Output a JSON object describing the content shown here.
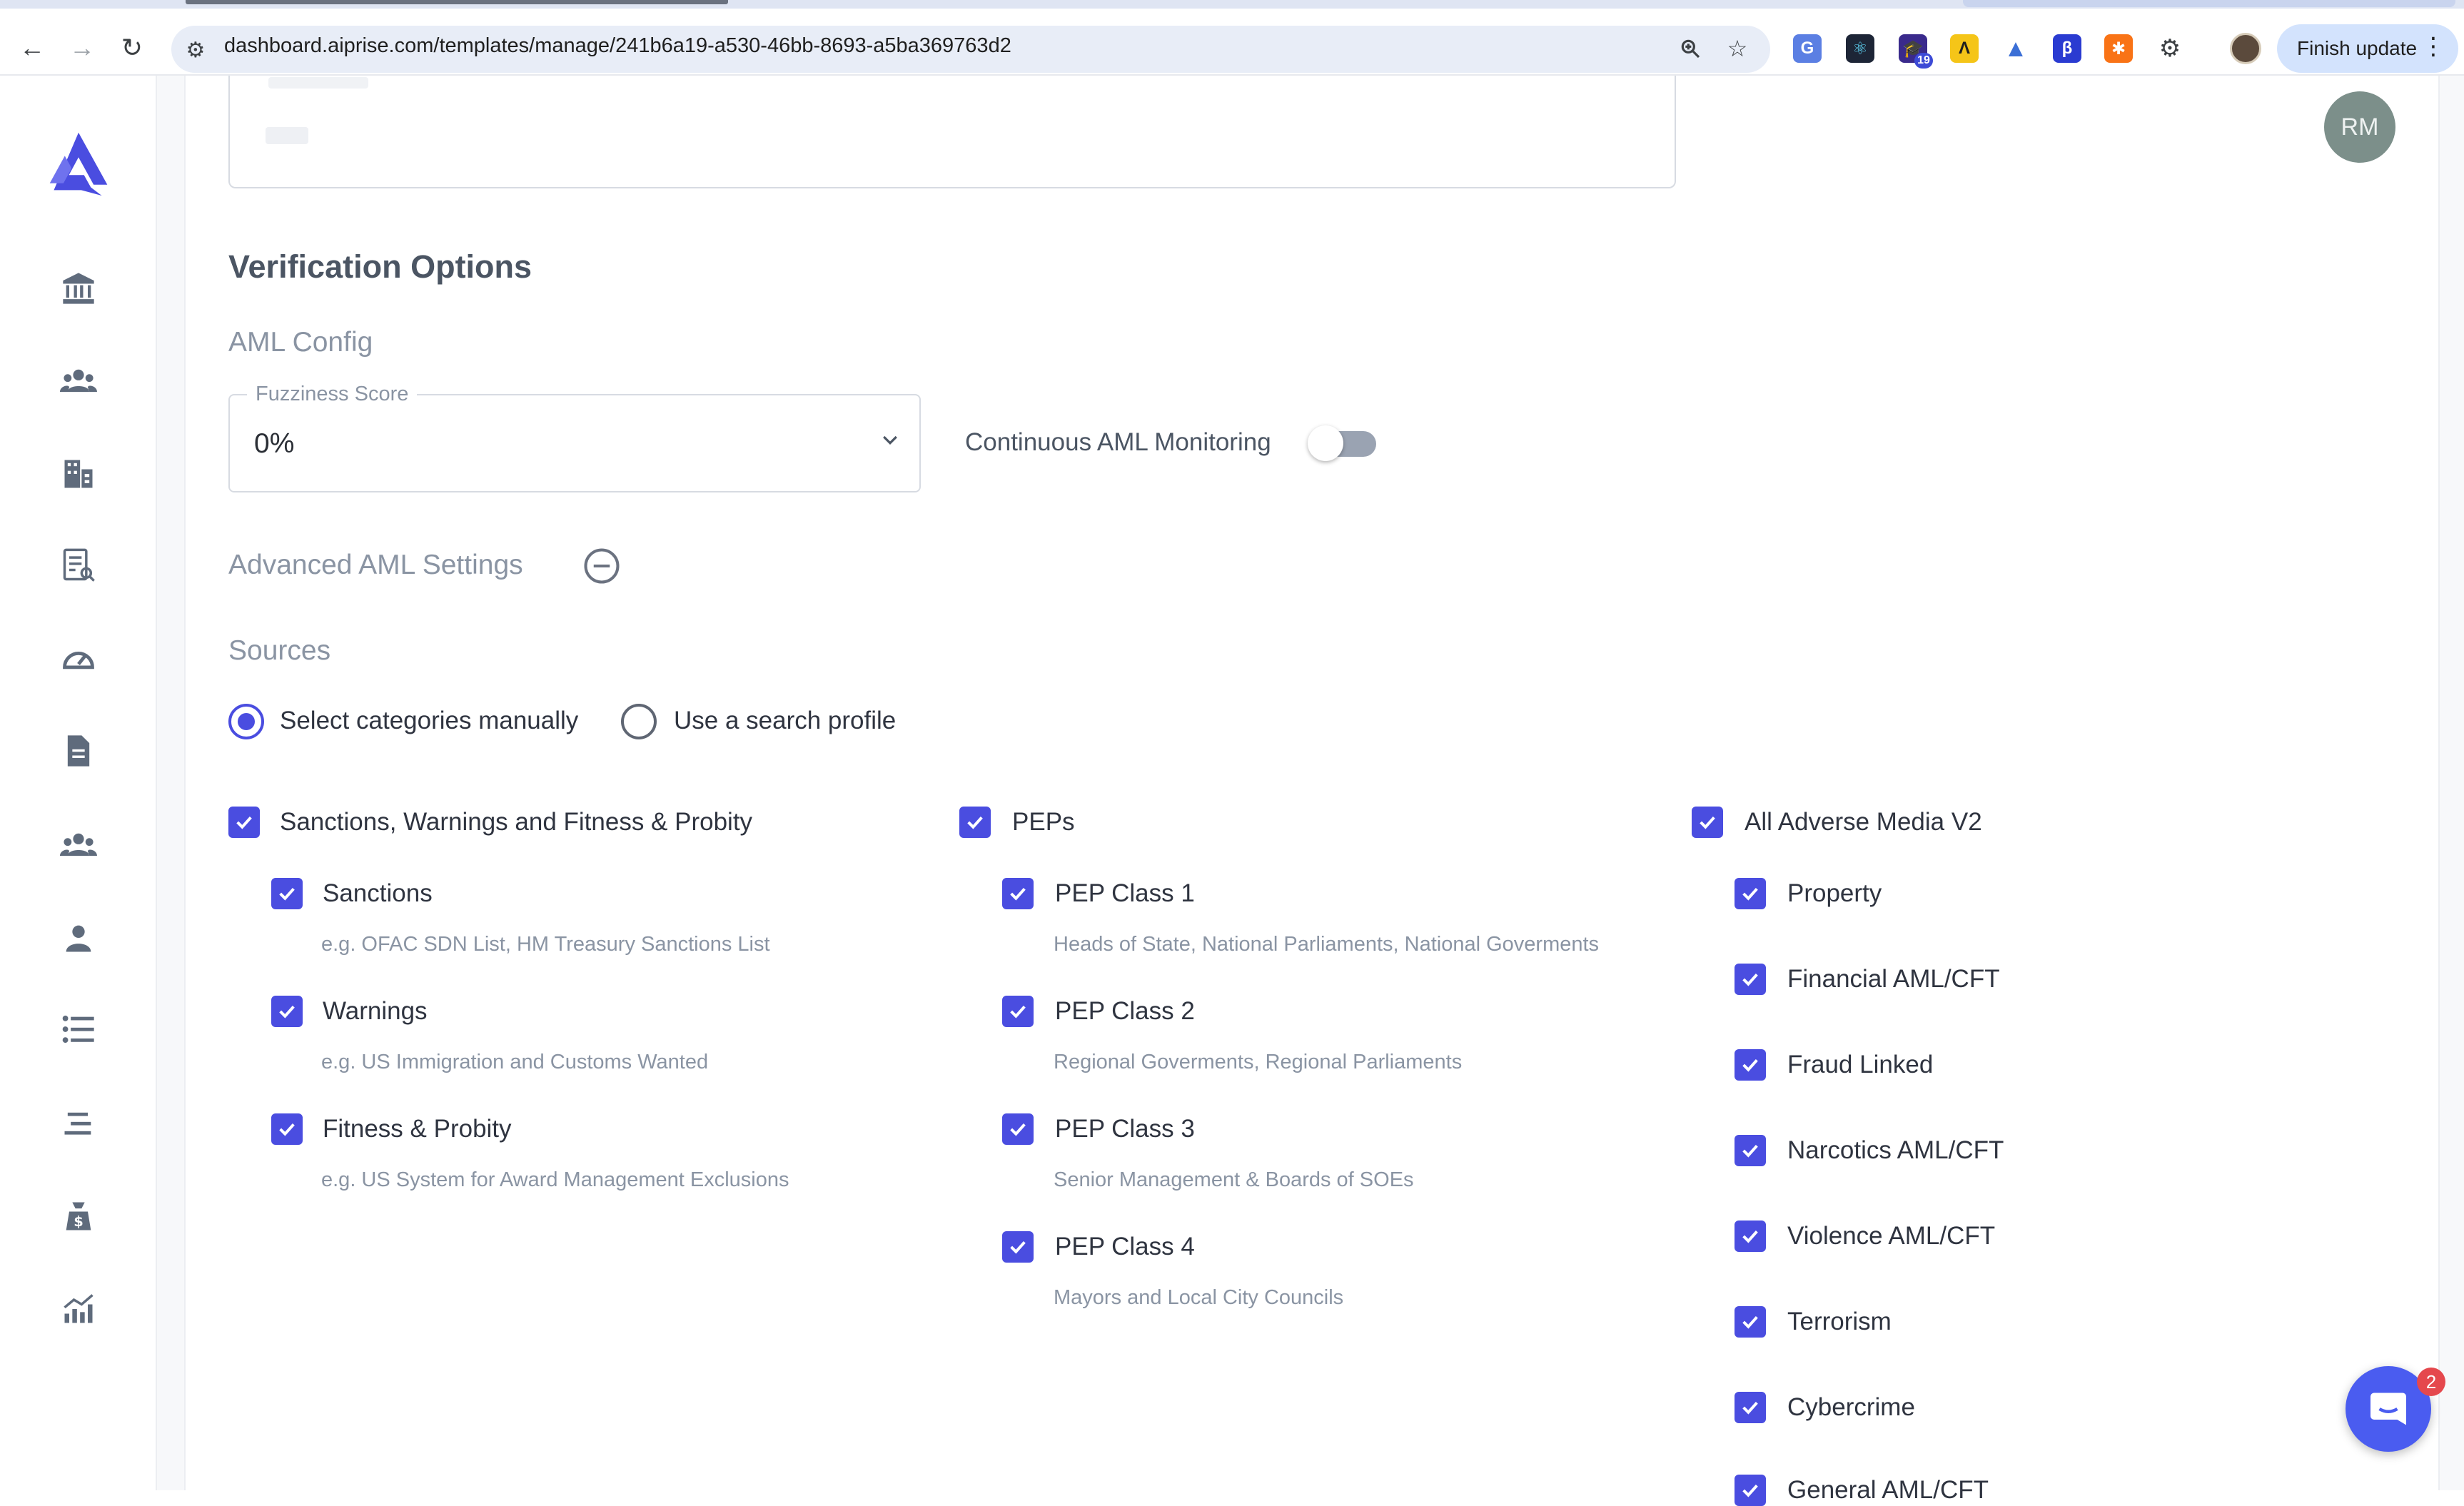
{
  "browser": {
    "url": "dashboard.aiprise.com/templates/manage/241b6a19-a530-46bb-8693-a5ba369763d2",
    "finish_update_label": "Finish update",
    "extension_badge": "19"
  },
  "user": {
    "initials": "RM"
  },
  "sidebar": {
    "items": [
      "bank-icon",
      "users-icon",
      "building-icon",
      "document-search-icon",
      "speedometer-icon",
      "file-icon",
      "team-icon",
      "person-icon",
      "list-icon",
      "align-icon",
      "money-bag-icon",
      "analytics-icon"
    ]
  },
  "verification": {
    "title": "Verification Options",
    "aml_config_title": "AML Config",
    "fuzziness_label": "Fuzziness Score",
    "fuzziness_value": "0%",
    "continuous_label": "Continuous AML Monitoring",
    "continuous_on": false,
    "advanced_title": "Advanced AML Settings",
    "sources_title": "Sources",
    "radio_manual": "Select categories manually",
    "radio_profile": "Use a search profile",
    "selected_radio": "manual"
  },
  "categories": {
    "sanctions": {
      "label": "Sanctions, Warnings and Fitness & Probity",
      "items": [
        {
          "label": "Sanctions",
          "hint": "e.g. OFAC SDN List, HM Treasury Sanctions List"
        },
        {
          "label": "Warnings",
          "hint": "e.g. US Immigration and Customs Wanted"
        },
        {
          "label": "Fitness & Probity",
          "hint": "e.g. US System for Award Management Exclusions"
        }
      ]
    },
    "peps": {
      "label": "PEPs",
      "items": [
        {
          "label": "PEP Class 1",
          "hint": "Heads of State, National Parliaments, National Goverments"
        },
        {
          "label": "PEP Class 2",
          "hint": "Regional Goverments, Regional Parliaments"
        },
        {
          "label": "PEP Class 3",
          "hint": "Senior Management & Boards of SOEs"
        },
        {
          "label": "PEP Class 4",
          "hint": "Mayors and Local City Councils"
        }
      ]
    },
    "adverse": {
      "label": "All Adverse Media V2",
      "items": [
        {
          "label": "Property"
        },
        {
          "label": "Financial AML/CFT"
        },
        {
          "label": "Fraud Linked"
        },
        {
          "label": "Narcotics AML/CFT"
        },
        {
          "label": "Violence AML/CFT"
        },
        {
          "label": "Terrorism"
        },
        {
          "label": "Cybercrime"
        },
        {
          "label": "General AML/CFT"
        }
      ]
    }
  },
  "chat": {
    "badge_count": "2"
  },
  "colors": {
    "accent": "#4a4de0",
    "chat": "#4a5cf0",
    "badge": "#e5484d"
  }
}
